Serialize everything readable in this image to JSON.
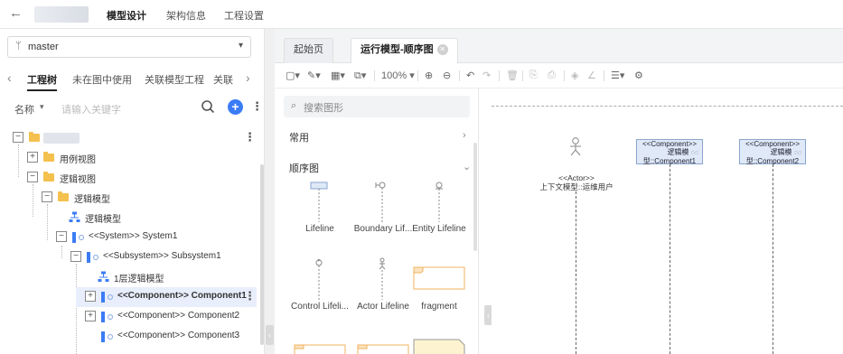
{
  "topbar": {
    "tabs": [
      "模型设计",
      "架构信息",
      "工程设置"
    ],
    "active_tab": 0
  },
  "left": {
    "branch": "master",
    "view_tabs": [
      "工程树",
      "未在图中使用",
      "关联模型工程",
      "关联"
    ],
    "search": {
      "field_label": "名称",
      "placeholder": "请输入关键字"
    },
    "tree": [
      {
        "label": "",
        "level": 0,
        "toggle": "−",
        "icon": "folder"
      },
      {
        "label": "用例视图",
        "level": 1,
        "toggle": "+",
        "icon": "folder"
      },
      {
        "label": "逻辑视图",
        "level": 1,
        "toggle": "−",
        "icon": "folder"
      },
      {
        "label": "逻辑模型",
        "level": 2,
        "toggle": "−",
        "icon": "folder"
      },
      {
        "label": "逻辑模型",
        "level": 3,
        "toggle": "",
        "icon": "model"
      },
      {
        "label": "<<System>> System1",
        "level": 3,
        "toggle": "−",
        "icon": "component"
      },
      {
        "label": "<<Subsystem>> Subsystem1",
        "level": 4,
        "toggle": "−",
        "icon": "component"
      },
      {
        "label": "1层逻辑模型",
        "level": 5,
        "toggle": "",
        "icon": "model"
      },
      {
        "label": "<<Component>> Component1",
        "level": 5,
        "toggle": "+",
        "icon": "component",
        "selected": true
      },
      {
        "label": "<<Component>> Component2",
        "level": 5,
        "toggle": "+",
        "icon": "component"
      },
      {
        "label": "<<Component>> Component3",
        "level": 5,
        "toggle": "",
        "icon": "component"
      }
    ]
  },
  "editor": {
    "tabs": [
      {
        "label": "起始页",
        "active": false
      },
      {
        "label": "运行模型-顺序图",
        "active": true
      }
    ],
    "zoom": "100%"
  },
  "palette": {
    "search_placeholder": "搜索图形",
    "sections": [
      {
        "label": "常用",
        "expanded": false
      },
      {
        "label": "顺序图",
        "expanded": true
      }
    ],
    "shapes": [
      "Lifeline",
      "Boundary Lif...",
      "Entity Lifeline",
      "Control Lifeli...",
      "Actor Lifeline",
      "fragment"
    ]
  },
  "canvas": {
    "actor": {
      "stereotype": "<<Actor>>",
      "name": "上下文模型::运维用户"
    },
    "components": [
      {
        "stereotype": "<<Component>>",
        "line2": "逻辑模",
        "line3": "型::Component1"
      },
      {
        "stereotype": "<<Component>>",
        "line2": "逻辑模",
        "line3": "型::Component2"
      }
    ]
  }
}
